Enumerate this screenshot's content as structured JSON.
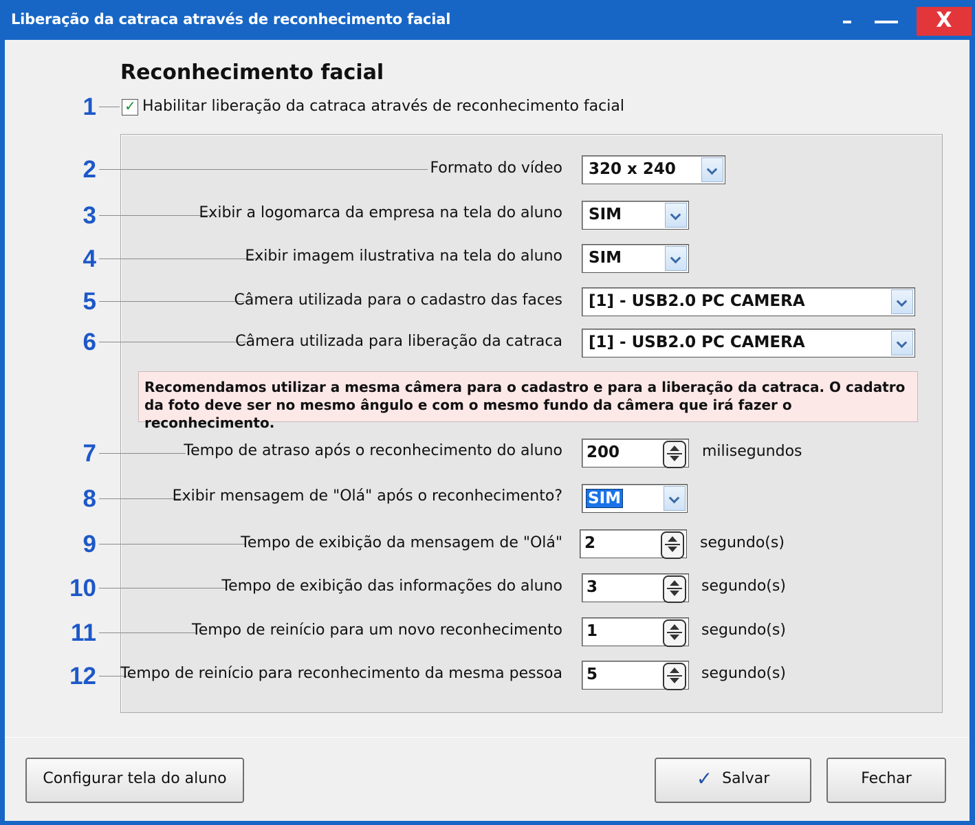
{
  "window": {
    "title": "Liberação da catraca através de reconhecimento facial",
    "min_label": "-",
    "max_label": "",
    "close_label": "X"
  },
  "section": {
    "title": "Reconhecimento facial"
  },
  "enable": {
    "number": "1",
    "label": "Habilitar liberação da catraca através de reconhecimento facial",
    "checked": true,
    "check_glyph": "✓"
  },
  "rows": [
    {
      "number": "2",
      "label": "Formato do vídeo",
      "value": "320 x 240"
    },
    {
      "number": "3",
      "label": "Exibir a logomarca da empresa na tela do aluno",
      "value": "SIM"
    },
    {
      "number": "4",
      "label": "Exibir imagem ilustrativa na tela do aluno",
      "value": "SIM"
    },
    {
      "number": "5",
      "label": "Câmera utilizada para o cadastro das faces",
      "value": "[1] - USB2.0 PC CAMERA"
    },
    {
      "number": "6",
      "label": "Câmera utilizada para liberação da catraca",
      "value": "[1] - USB2.0 PC CAMERA"
    },
    {
      "number": "7",
      "label": "Tempo de atraso após o reconhecimento do aluno",
      "value": "200",
      "unit": "milisegundos"
    },
    {
      "number": "8",
      "label": "Exibir mensagem de \"Olá\" após o reconhecimento?",
      "value": "SIM"
    },
    {
      "number": "9",
      "label": "Tempo de exibição da mensagem de \"Olá\"",
      "value": "2",
      "unit": "segundo(s)"
    },
    {
      "number": "10",
      "label": "Tempo de exibição das informações do aluno",
      "value": "3",
      "unit": "segundo(s)"
    },
    {
      "number": "11",
      "label": "Tempo de reinício para um novo reconhecimento",
      "value": "1",
      "unit": "segundo(s)"
    },
    {
      "number": "12",
      "label": "Tempo de reinício para reconhecimento da mesma pessoa",
      "value": "5",
      "unit": "segundo(s)"
    }
  ],
  "warning": "Recomendamos utilizar a mesma câmera para o cadastro e para a liberação da catraca. O cadatro da foto deve ser no mesmo ângulo e com o mesmo fundo da câmera que irá fazer o reconhecimento.",
  "buttons": {
    "configure": "Configurar tela do aluno",
    "save": "Salvar",
    "save_icon": "✓",
    "close": "Fechar"
  },
  "colors": {
    "titlebar": "#1766c6",
    "close": "#e3363a",
    "numbers": "#1d58c8",
    "warning_bg": "#fde8e8"
  }
}
